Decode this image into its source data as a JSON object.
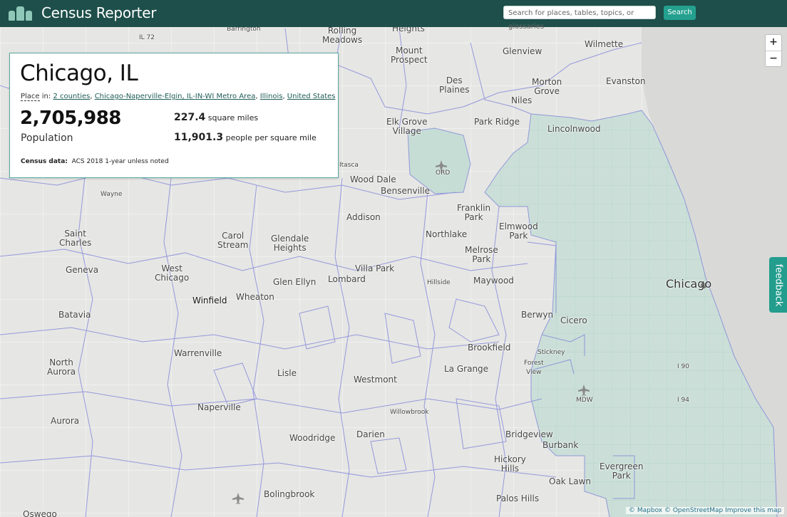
{
  "header": {
    "app_title": "Census Reporter",
    "search_placeholder": "Search for places, tables, topics, or glossaries",
    "search_button": "Search"
  },
  "profile": {
    "name": "Chicago, IL",
    "place_in_label": "Place",
    "place_in_suffix": " in: ",
    "parents": [
      "2 counties",
      "Chicago-Naperville-Elgin, IL-IN-WI Metro Area",
      "Illinois",
      "United States"
    ],
    "population_value": "2,705,988",
    "population_label": "Population",
    "area_value": "227.4",
    "area_label": "square miles",
    "density_value": "11,901.3",
    "density_label": "people per square mile",
    "census_data_label": "Census data:",
    "census_data_value": "ACS 2018 1-year unless noted"
  },
  "map_controls": {
    "zoom_in": "+",
    "zoom_out": "−"
  },
  "feedback_label": "feedback",
  "attribution": "© Mapbox © OpenStreetMap Improve this map",
  "map_labels": {
    "barrington": "Barrington",
    "rolling_meadows": "Rolling\nMeadows",
    "heights": "Heights",
    "mount_prospect": "Mount\nProspect",
    "glenview": "Glenview",
    "wilmette": "Wilmette",
    "des_plaines": "Des\nPlaines",
    "morton_grove": "Morton\nGrove",
    "evanston": "Evanston",
    "niles": "Niles",
    "elk_grove": "Elk Grove\nVillage",
    "park_ridge": "Park Ridge",
    "lincolnwood": "Lincolnwood",
    "ord": "ORD",
    "itasca": "Itasca",
    "wood_dale": "Wood Dale",
    "bensenville": "Bensenville",
    "wayne": "Wayne",
    "franklin_park": "Franklin\nPark",
    "addison": "Addison",
    "elmwood_park": "Elmwood\nPark",
    "saint_charles": "Saint\nCharles",
    "carol_stream": "Carol\nStream",
    "glendale_heights": "Glendale\nHeights",
    "northlake": "Northlake",
    "melrose_park": "Melrose\nPark",
    "geneva": "Geneva",
    "west_chicago": "West\nChicago",
    "villa_park": "Villa Park",
    "chicago": "Chicago",
    "glen_ellyn": "Glen Ellyn",
    "lombard": "Lombard",
    "hillside": "Hillside",
    "maywood": "Maywood",
    "winfield": "Winfield",
    "wheaton": "Wheaton",
    "batavia": "Batavia",
    "berwyn": "Berwyn",
    "cicero": "Cicero",
    "warrenville": "Warrenville",
    "brookfield": "Brookfield",
    "stickney": "Stickney",
    "forest_view": "Forest\nView",
    "north_aurora": "North\nAurora",
    "lisle": "Lisle",
    "la_grange": "La Grange",
    "westmont": "Westmont",
    "i90": "I 90",
    "mdw": "MDW",
    "i94": "I 94",
    "naperville": "Naperville",
    "willowbrook": "Willowbrook",
    "aurora": "Aurora",
    "woodridge": "Woodridge",
    "darien": "Darien",
    "bridgeview": "Bridgeview",
    "burbank": "Burbank",
    "hickory_hills": "Hickory\nHills",
    "evergreen_park": "Evergreen\nPark",
    "oak_lawn": "Oak Lawn",
    "bolingbrook": "Bolingbrook",
    "palos_hills": "Palos Hills",
    "oswego": "Oswego",
    "il72": "IL 72"
  }
}
